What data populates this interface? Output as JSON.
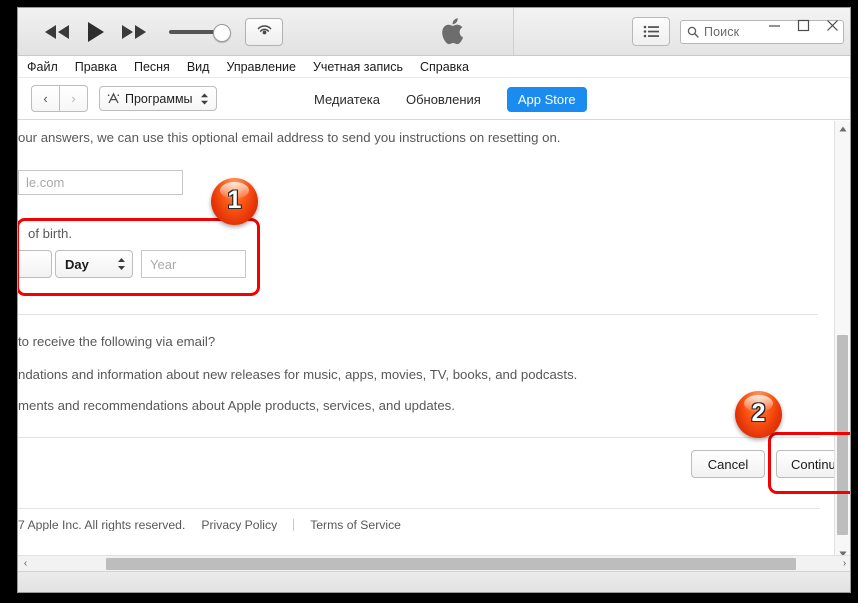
{
  "window": {
    "controls": {
      "minimize": "—",
      "maximize": "□",
      "close": "✕"
    }
  },
  "toolbar": {
    "rewind_icon": "rewind-icon",
    "play_icon": "play-icon",
    "fastforward_icon": "fast-forward-icon",
    "volume_icon": "volume-slider",
    "airplay_icon": "airplay-icon",
    "apple_logo_icon": "apple-logo-icon",
    "list_icon": "list-view-icon",
    "search_placeholder": "Поиск",
    "search_value": ""
  },
  "menubar": {
    "items": [
      {
        "label": "Файл"
      },
      {
        "label": "Правка"
      },
      {
        "label": "Песня"
      },
      {
        "label": "Вид"
      },
      {
        "label": "Управление"
      },
      {
        "label": "Учетная запись"
      },
      {
        "label": "Справка"
      }
    ]
  },
  "navbar": {
    "back_icon": "‹",
    "forward_icon": "›",
    "media_picker_label": "Программы",
    "media_picker_chevron": "⌃⌄",
    "tabs": [
      {
        "label": "Медиатека",
        "active": false
      },
      {
        "label": "Обновления",
        "active": false
      },
      {
        "label": "App Store",
        "active": true
      }
    ],
    "active_tab_color": "#1a8cf0"
  },
  "form": {
    "intro_text": "our answers, we can use this optional email address to send you instructions on resetting on.",
    "email_placeholder": "le.com",
    "dob_label": "of birth.",
    "month_value": "",
    "day_value": "Day",
    "day_stepper_icon": "stepper-up-down-icon",
    "year_placeholder": "Year",
    "prefs_question": "to receive the following via email?",
    "pref_option_1": "ndations and information about new releases for music, apps, movies, TV, books, and podcasts.",
    "pref_option_2": "ments and recommendations about Apple products, services, and updates.",
    "cancel_label": "Cancel",
    "continue_label": "Continue"
  },
  "footer": {
    "copyright": "7 Apple Inc. All rights reserved.",
    "privacy_link": "Privacy Policy",
    "terms_link": "Terms of Service"
  },
  "annotations": {
    "badge_1": "1",
    "badge_2": "2",
    "highlight_color": "#f40000"
  },
  "scrollbars": {
    "v_up_icon": "▲",
    "v_down_icon": "▼",
    "h_left_icon": "‹",
    "h_right_icon": "›"
  }
}
